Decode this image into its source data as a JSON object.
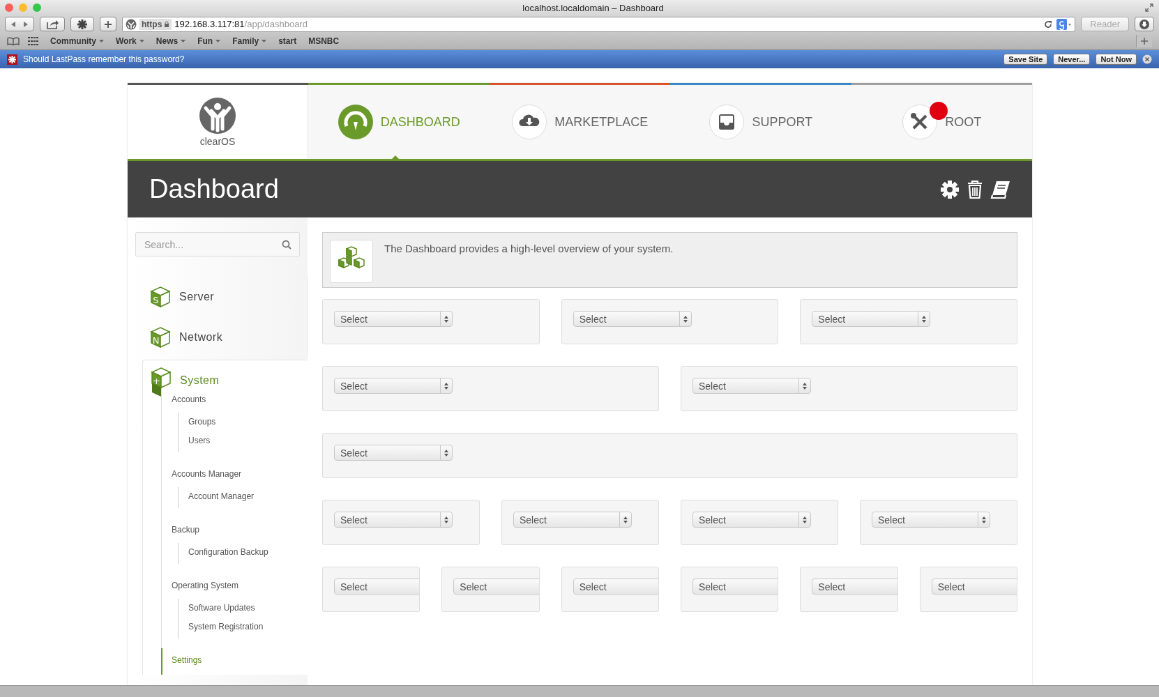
{
  "browser": {
    "title": "localhost.localdomain – Dashboard",
    "address": {
      "scheme": "https",
      "host": "192.168.3.117:81",
      "path": "/app/dashboard"
    },
    "reader_button": {
      "label": "Reader",
      "disabled": true
    },
    "bookmarks": [
      {
        "label": "Community",
        "has_menu": true
      },
      {
        "label": "Work",
        "has_menu": true
      },
      {
        "label": "News",
        "has_menu": true
      },
      {
        "label": "Fun",
        "has_menu": true
      },
      {
        "label": "Family",
        "has_menu": true
      },
      {
        "label": "start",
        "has_menu": false
      },
      {
        "label": "MSNBC",
        "has_menu": false
      }
    ]
  },
  "lastpass_bar": {
    "message": "Should LastPass remember this password?",
    "buttons": [
      "Save Site",
      "Never...",
      "Not Now"
    ]
  },
  "app": {
    "logo_text": "clearOS",
    "nav": [
      {
        "label": "DASHBOARD",
        "kind": "dashboard",
        "selected": true,
        "color": "#6a9a2a",
        "notification": false
      },
      {
        "label": "MARKETPLACE",
        "kind": "marketplace",
        "selected": false,
        "color": "#d9532b",
        "notification": false
      },
      {
        "label": "SUPPORT",
        "kind": "support",
        "selected": false,
        "color": "#3b88c8",
        "notification": false
      },
      {
        "label": "ROOT",
        "kind": "root",
        "selected": false,
        "color": "#a0a0a0",
        "notification": true
      }
    ],
    "page_title": "Dashboard",
    "sidebar": {
      "search": {
        "placeholder": "Search..."
      },
      "categories": [
        {
          "label": "Server",
          "letter": "S",
          "expanded": false
        },
        {
          "label": "Network",
          "letter": "N",
          "expanded": false
        },
        {
          "label": "System",
          "letter": "+",
          "expanded": true,
          "children": [
            {
              "label": "Accounts",
              "selected": false,
              "children": [
                {
                  "label": "Groups"
                },
                {
                  "label": "Users"
                }
              ]
            },
            {
              "label": "Accounts Manager",
              "selected": false,
              "children": [
                {
                  "label": "Account Manager"
                }
              ]
            },
            {
              "label": "Backup",
              "selected": false,
              "children": [
                {
                  "label": "Configuration Backup"
                }
              ]
            },
            {
              "label": "Operating System",
              "selected": false,
              "children": [
                {
                  "label": "Software Updates"
                },
                {
                  "label": "System Registration"
                }
              ]
            },
            {
              "label": "Settings",
              "selected": true
            }
          ]
        }
      ]
    },
    "intro": {
      "text": "The Dashboard provides a high-level overview of your system."
    },
    "widget_rows": [
      [
        {
          "value": "Select"
        },
        {
          "value": "Select"
        },
        {
          "value": "Select"
        }
      ],
      [
        {
          "value": "Select"
        },
        {
          "value": "Select"
        }
      ],
      [
        {
          "value": "Select"
        }
      ],
      [
        {
          "value": "Select"
        },
        {
          "value": "Select"
        },
        {
          "value": "Select"
        },
        {
          "value": "Select"
        }
      ],
      [
        {
          "value": "Select"
        },
        {
          "value": "Select"
        },
        {
          "value": "Select"
        },
        {
          "value": "Select"
        },
        {
          "value": "Select"
        },
        {
          "value": "Select"
        }
      ]
    ]
  }
}
